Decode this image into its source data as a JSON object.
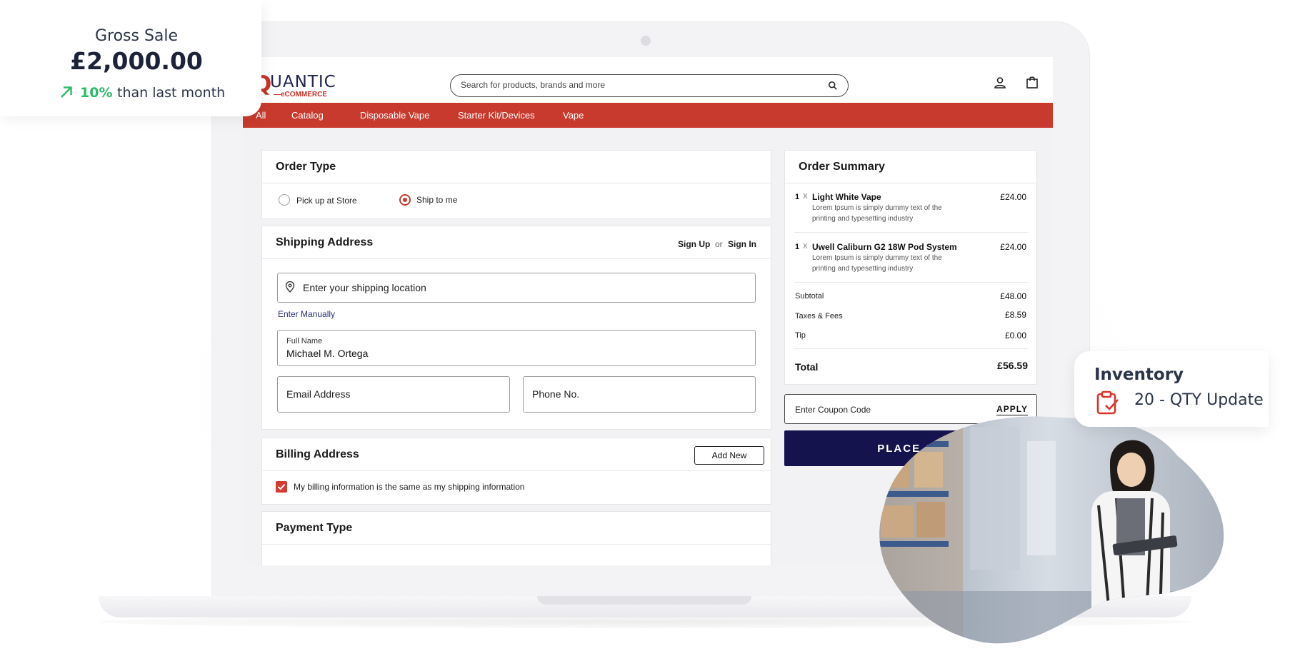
{
  "gross_sale": {
    "title": "Gross Sale",
    "value": "£2,000.00",
    "change_pct": "10%",
    "comparison": "than last month"
  },
  "header": {
    "logo_letter": "Q",
    "logo_text": "UANTIC",
    "logo_sub": "—eCOMMERCE",
    "search_placeholder": "Search for products, brands and more"
  },
  "nav": {
    "items": [
      "All",
      "Catalog",
      "Disposable Vape",
      "Starter Kit/Devices",
      "Vape"
    ]
  },
  "order_type": {
    "title": "Order Type",
    "options": [
      "Pick up at Store",
      "Ship to me"
    ],
    "selected": "Ship to me"
  },
  "shipping": {
    "title": "Shipping Address",
    "sign_up": "Sign Up",
    "or": "or",
    "sign_in": "Sign In",
    "location_placeholder": "Enter your shipping location",
    "enter_manually": "Enter Manually",
    "full_name_label": "Full Name",
    "full_name_value": "Michael M. Ortega",
    "email_placeholder": "Email Address",
    "phone_placeholder": "Phone No."
  },
  "billing": {
    "title": "Billing Address",
    "add_new": "Add New",
    "same_as_shipping": "My billing information is the same as my shipping information",
    "same_checked": true
  },
  "payment": {
    "title": "Payment Type"
  },
  "summary": {
    "title": "Order Summary",
    "items": [
      {
        "qty": "1",
        "x": "X",
        "name": "Light White Vape",
        "desc": "Lorem Ipsum is simply dummy text of the printing and typesetting industry",
        "price": "£24.00"
      },
      {
        "qty": "1",
        "x": "X",
        "name": "Uwell Caliburn G2 18W Pod System",
        "desc": "Lorem Ipsum is simply dummy text of the printing and typesetting industry",
        "price": "£24.00"
      }
    ],
    "subtotal_label": "Subtotal",
    "subtotal": "£48.00",
    "taxes_label": "Taxes & Fees",
    "taxes": "£8.59",
    "tip_label": "Tip",
    "tip": "£0.00",
    "total_label": "Total",
    "total": "£56.59",
    "coupon_placeholder": "Enter Coupon Code",
    "apply": "APPLY",
    "place_order": "PLACE OR"
  },
  "inventory": {
    "title": "Inventory",
    "update": "20 - QTY Update"
  },
  "colors": {
    "brand_red": "#c93a2e",
    "navy": "#15134d",
    "positive_green": "#2fb96a",
    "text_dark": "#2b3548"
  }
}
